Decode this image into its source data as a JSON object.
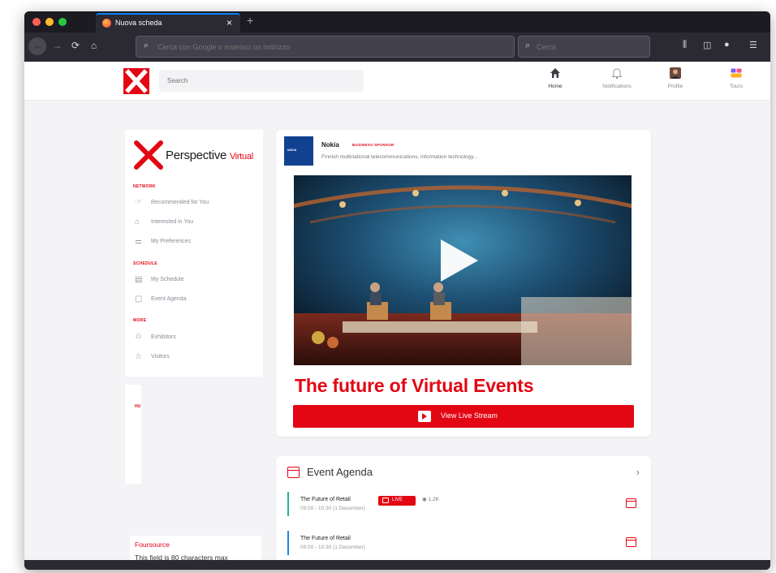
{
  "browser": {
    "tab_title": "Nuova scheda",
    "url_placeholder": "Cerca con Google o inserisci un indirizzo",
    "search_placeholder": "Cerca",
    "colors": {
      "chrome": "#1c1b22",
      "toolbar": "#2b2a33",
      "tab_accent": "#0a84ff"
    }
  },
  "site": {
    "search_placeholder": "Search",
    "nav": [
      {
        "label": "Home",
        "icon": "home-icon"
      },
      {
        "label": "Notifications",
        "icon": "bell-icon"
      },
      {
        "label": "Profile",
        "icon": "avatar-icon"
      },
      {
        "label": "Tours",
        "icon": "tours-icon"
      }
    ],
    "brand": {
      "name": "Perspective",
      "suffix": "Virtual",
      "accent": "#e30613"
    }
  },
  "sidebar": {
    "sections": [
      {
        "label": "NETWORK",
        "items": [
          {
            "label": "Recommended for You",
            "icon": "thumbs-up-icon"
          },
          {
            "label": "Interested in You",
            "icon": "home-outline-icon"
          },
          {
            "label": "My Preferences",
            "icon": "sliders-icon"
          }
        ]
      },
      {
        "label": "SCHEDULE",
        "items": [
          {
            "label": "My Schedule",
            "icon": "calendar-check-icon"
          },
          {
            "label": "Event Agenda",
            "icon": "calendar-icon"
          }
        ]
      },
      {
        "label": "MORE",
        "items": [
          {
            "label": "Exhibitors",
            "icon": "handshake-icon"
          },
          {
            "label": "Visitors",
            "icon": "star-icon"
          }
        ]
      }
    ],
    "card2_label": "HU",
    "foursource": {
      "title": "Foursource",
      "text": "This field is 80 characters max"
    }
  },
  "sponsor": {
    "logo_text": "NOKIA",
    "name": "Nokia",
    "badge": "BUSINESS SPONSOR",
    "description": "Finnish multinational telecommunications, information technology..."
  },
  "event": {
    "title": "The future of Virtual Events",
    "live_button": "View Live Stream"
  },
  "agenda": {
    "title": "Event Agenda",
    "rows": [
      {
        "title": "The Future of Retail",
        "time": "09:00 - 10:30 (1 December)",
        "live_label": "LIVE",
        "viewers": "1.2K",
        "bar_color": "#25b39e"
      },
      {
        "title": "The Future of Retail",
        "time": "09:00 - 10:30 (1 December)",
        "bar_color": "#1e88e5"
      }
    ]
  }
}
